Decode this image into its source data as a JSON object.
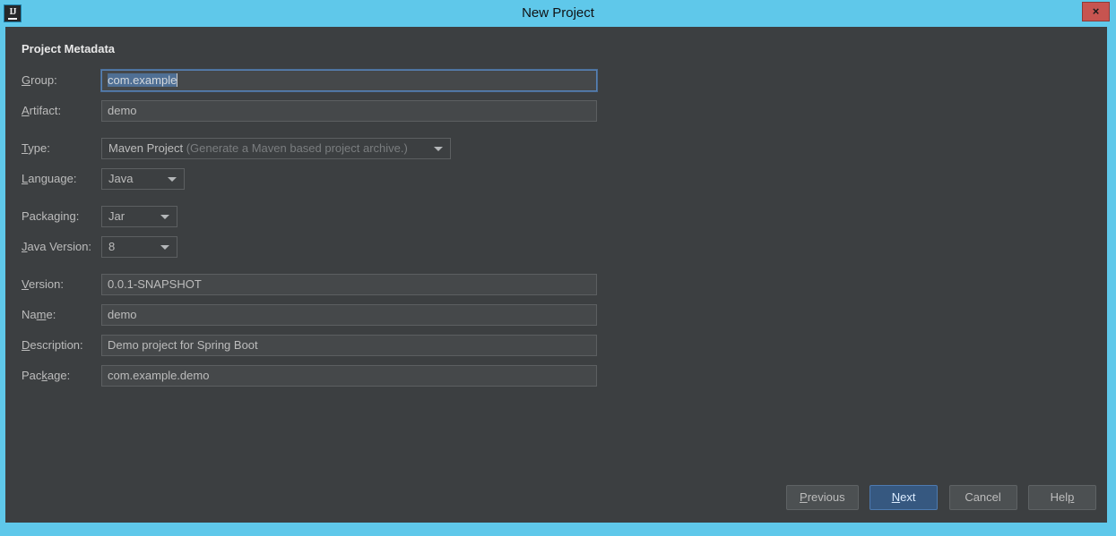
{
  "window": {
    "title": "New Project",
    "app_icon_name": "intellij-idea-icon",
    "close_label": "×",
    "chrome_color": "#5fc8ea",
    "dialog_bg": "#3c3f41"
  },
  "form": {
    "section_title": "Project Metadata",
    "fields": [
      {
        "id": "group",
        "label_pre": "",
        "label_mnemonic": "G",
        "label_post": "roup:",
        "kind": "text",
        "value": "com.example",
        "focused": true,
        "selected": true
      },
      {
        "id": "artifact",
        "label_pre": "",
        "label_mnemonic": "A",
        "label_post": "rtifact:",
        "kind": "text",
        "value": "demo",
        "focused": false,
        "selected": false
      },
      {
        "id": "type",
        "label_pre": "",
        "label_mnemonic": "T",
        "label_post": "ype:",
        "kind": "combo",
        "value": "Maven Project",
        "value_hint": "(Generate a Maven based project archive.)"
      },
      {
        "id": "language",
        "label_pre": "",
        "label_mnemonic": "L",
        "label_post": "anguage:",
        "kind": "combo",
        "value": "Java",
        "value_hint": ""
      },
      {
        "id": "packaging",
        "label_pre": "Packa",
        "label_mnemonic": "g",
        "label_post": "ing:",
        "kind": "combo",
        "value": "Jar",
        "value_hint": ""
      },
      {
        "id": "java-version",
        "label_pre": "",
        "label_mnemonic": "J",
        "label_post": "ava Version:",
        "kind": "combo",
        "value": "8",
        "value_hint": ""
      },
      {
        "id": "version",
        "label_pre": "",
        "label_mnemonic": "V",
        "label_post": "ersion:",
        "kind": "text",
        "value": "0.0.1-SNAPSHOT",
        "focused": false,
        "selected": false
      },
      {
        "id": "name",
        "label_pre": "Na",
        "label_mnemonic": "m",
        "label_post": "e:",
        "kind": "text",
        "value": "demo",
        "focused": false,
        "selected": false
      },
      {
        "id": "description",
        "label_pre": "",
        "label_mnemonic": "D",
        "label_post": "escription:",
        "kind": "text",
        "value": "Demo project for Spring Boot",
        "focused": false,
        "selected": false
      },
      {
        "id": "package",
        "label_pre": "Pac",
        "label_mnemonic": "k",
        "label_post": "age:",
        "kind": "text",
        "value": "com.example.demo",
        "focused": false,
        "selected": false
      }
    ]
  },
  "footer": {
    "buttons": [
      {
        "id": "previous",
        "pre": "",
        "mnemonic": "P",
        "post": "revious",
        "default": false
      },
      {
        "id": "next",
        "pre": "",
        "mnemonic": "N",
        "post": "ext",
        "default": true
      },
      {
        "id": "cancel",
        "pre": "Cancel",
        "mnemonic": "",
        "post": "",
        "default": false
      },
      {
        "id": "help",
        "pre": "Hel",
        "mnemonic": "p",
        "post": "",
        "default": false
      }
    ]
  }
}
